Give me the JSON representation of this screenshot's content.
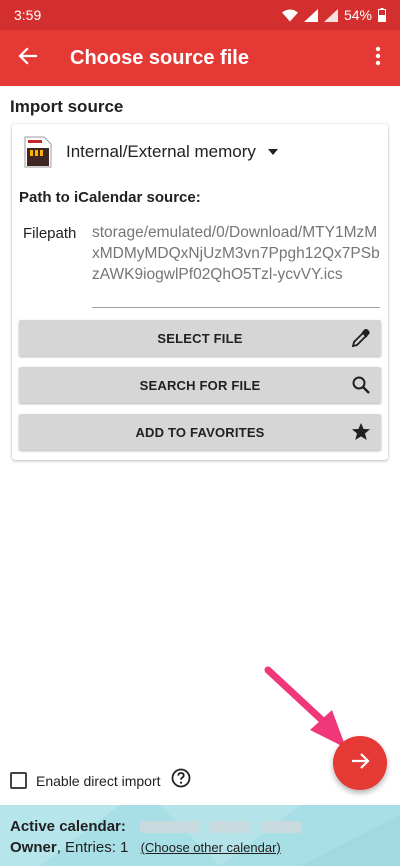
{
  "status_bar": {
    "time": "3:59",
    "battery": "54%"
  },
  "app_bar": {
    "title": "Choose source file"
  },
  "import_source": {
    "heading": "Import source",
    "source_label": "Internal/External memory",
    "path_heading": "Path to iCalendar source:",
    "filepath_label": "Filepath",
    "filepath_value": "storage/emulated/0/Download/MTY1MzMxMDMyMDQxNjUzM3vn7Ppgh12Qx7PSbzAWK9iogwlPf02QhO5Tzl-ycvVY.ics"
  },
  "buttons": {
    "select_file": "SELECT FILE",
    "search_for_file": "SEARCH FOR FILE",
    "add_to_favorites": "ADD TO FAVORITES"
  },
  "options": {
    "enable_direct_import": "Enable direct import"
  },
  "footer": {
    "active_calendar_label": "Active calendar:",
    "owner_label": "Owner",
    "entries_label": ", Entries:",
    "entries_count": "1",
    "choose_other": "(Choose other calendar)"
  },
  "icons": {
    "back": "arrow-left-icon",
    "more": "more-vert-icon",
    "select_file": "eyedropper-icon",
    "search_for_file": "search-icon",
    "add_to_favorites": "star-icon",
    "help": "help-circle-icon",
    "next": "arrow-right-icon"
  },
  "colors": {
    "status_bar": "#d32f2f",
    "app_bar": "#e53935",
    "fab": "#e53935",
    "footer": "#a8dfe6",
    "annotation_arrow": "#f0377a"
  }
}
